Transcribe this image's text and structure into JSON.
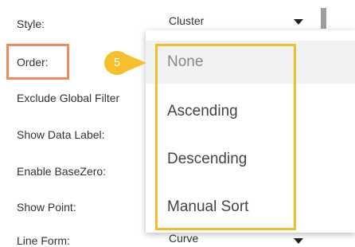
{
  "settings": {
    "style_label": "Style:",
    "style_value": "Cluster",
    "order_label": "Order:",
    "exclude_label": "Exclude Global Filter",
    "show_data_label": "Show Data Label:",
    "basezero_label": "Enable BaseZero:",
    "show_point_label": "Show Point:",
    "line_form_label": "Line Form:",
    "line_form_value": "Curve"
  },
  "dropdown": {
    "options": [
      "None",
      "Ascending",
      "Descending",
      "Manual Sort"
    ],
    "selected_index": 0
  },
  "callout": {
    "step_number": "5"
  },
  "colors": {
    "order_highlight": "#ee8a5f",
    "options_highlight": "#f3be2a",
    "step_badge": "#f5c02c"
  }
}
